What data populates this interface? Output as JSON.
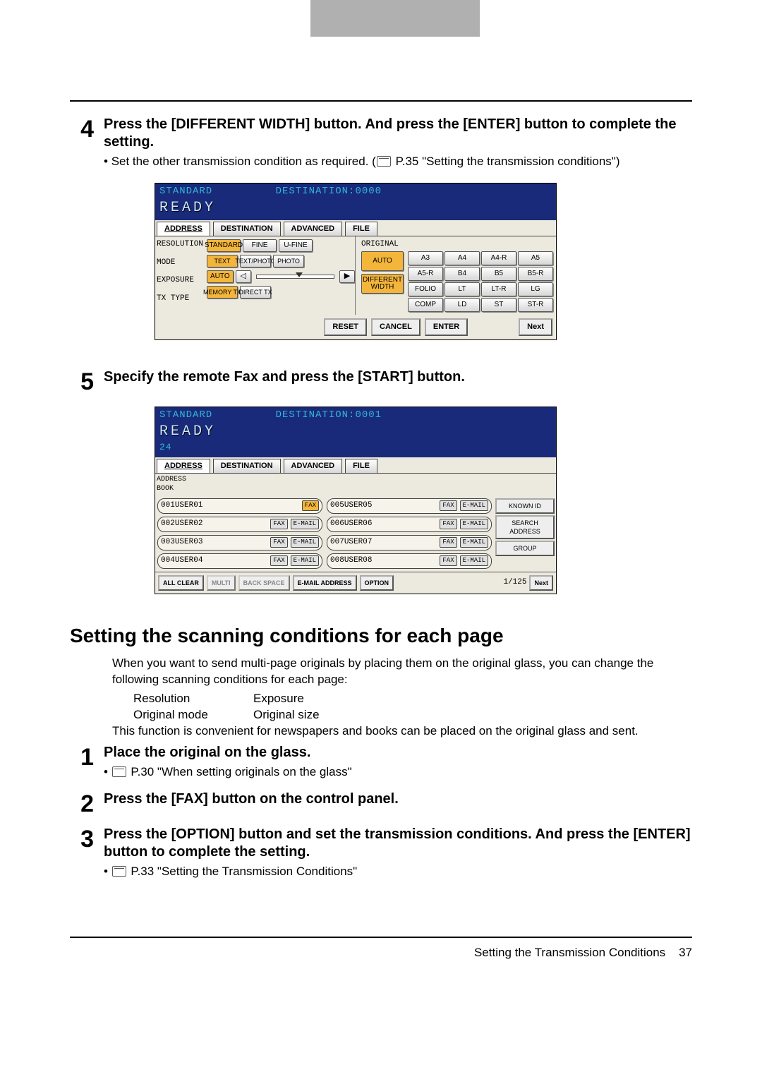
{
  "step4": {
    "num": "4",
    "head": "Press the [DIFFERENT WIDTH] button. And press the [ENTER] button to complete the setting.",
    "bullet": "Set the other transmission condition as required.",
    "ref": "P.35 \"Setting the transmission conditions\""
  },
  "panel1": {
    "standard": "STANDARD",
    "dest": "DESTINATION:0000",
    "ready": "READY",
    "tabs": {
      "address": "ADDRESS",
      "destination": "DESTINATION",
      "advanced": "ADVANCED",
      "file": "FILE"
    },
    "left": {
      "resolution": "RESOLUTION",
      "mode": "MODE",
      "exposure": "EXPOSURE",
      "txtype": "TX TYPE"
    },
    "res": {
      "standard": "STANDARD",
      "fine": "FINE",
      "ufine": "U-FINE"
    },
    "mode": {
      "text": "TEXT",
      "textphoto": "TEXT/PHOTO",
      "photo": "PHOTO"
    },
    "exposure": {
      "auto": "AUTO"
    },
    "tx": {
      "memory": "MEMORY TX",
      "direct": "DIRECT TX"
    },
    "original_label": "ORIGINAL",
    "side": {
      "auto": "AUTO",
      "diff1": "DIFFERENT",
      "diff2": "WIDTH"
    },
    "sizes": [
      "A3",
      "A4",
      "A4-R",
      "A5",
      "A5-R",
      "B4",
      "B5",
      "B5-R",
      "FOLIO",
      "LT",
      "LT-R",
      "LG",
      "COMP",
      "LD",
      "ST",
      "ST-R"
    ],
    "foot": {
      "reset": "RESET",
      "cancel": "CANCEL",
      "enter": "ENTER",
      "next": "Next"
    }
  },
  "step5": {
    "num": "5",
    "head": "Specify the remote Fax and press the [START] button."
  },
  "panel2": {
    "standard": "STANDARD",
    "dest": "DESTINATION:0001",
    "ready": "READY",
    "count": "24",
    "tabs": {
      "address": "ADDRESS",
      "destination": "DESTINATION",
      "advanced": "ADVANCED",
      "file": "FILE"
    },
    "addr_book": "ADDRESS BOOK",
    "users_left": [
      {
        "id": "001",
        "name": "USER01"
      },
      {
        "id": "002",
        "name": "USER02"
      },
      {
        "id": "003",
        "name": "USER03"
      },
      {
        "id": "004",
        "name": "USER04"
      }
    ],
    "users_right": [
      {
        "id": "005",
        "name": "USER05"
      },
      {
        "id": "006",
        "name": "USER06"
      },
      {
        "id": "007",
        "name": "USER07"
      },
      {
        "id": "008",
        "name": "USER08"
      }
    ],
    "pill_fax": "FAX",
    "pill_email": "E-MAIL",
    "knobs": {
      "known": "KNOWN ID",
      "search": "SEARCH ADDRESS",
      "group": "GROUP"
    },
    "foot": {
      "allclear": "ALL CLEAR",
      "multi": "MULTI",
      "backspace": "BACK SPACE",
      "emailaddr": "E-MAIL ADDRESS",
      "option": "OPTION",
      "page": "1/125",
      "next": "Next"
    }
  },
  "section": {
    "title": "Setting the scanning conditions for each page",
    "p1": "When you want to send multi-page originals by placing them on the original glass, you can change the following scanning conditions for each page:",
    "tbl": {
      "a": "Resolution",
      "b": "Exposure",
      "c": "Original mode",
      "d": "Original size"
    },
    "p2": "This function is convenient for newspapers and books can be placed on the original glass and sent."
  },
  "step1": {
    "num": "1",
    "head": "Place the original on the glass.",
    "ref": "P.30 \"When setting originals on the glass\""
  },
  "step2": {
    "num": "2",
    "head": "Press the [FAX] button on the control panel."
  },
  "step3": {
    "num": "3",
    "head": "Press the [OPTION] button and set the transmission conditions. And press the [ENTER] button to complete the setting.",
    "ref": "P.33 \"Setting the Transmission Conditions\""
  },
  "footer": {
    "text": "Setting the Transmission Conditions",
    "page": "37"
  }
}
